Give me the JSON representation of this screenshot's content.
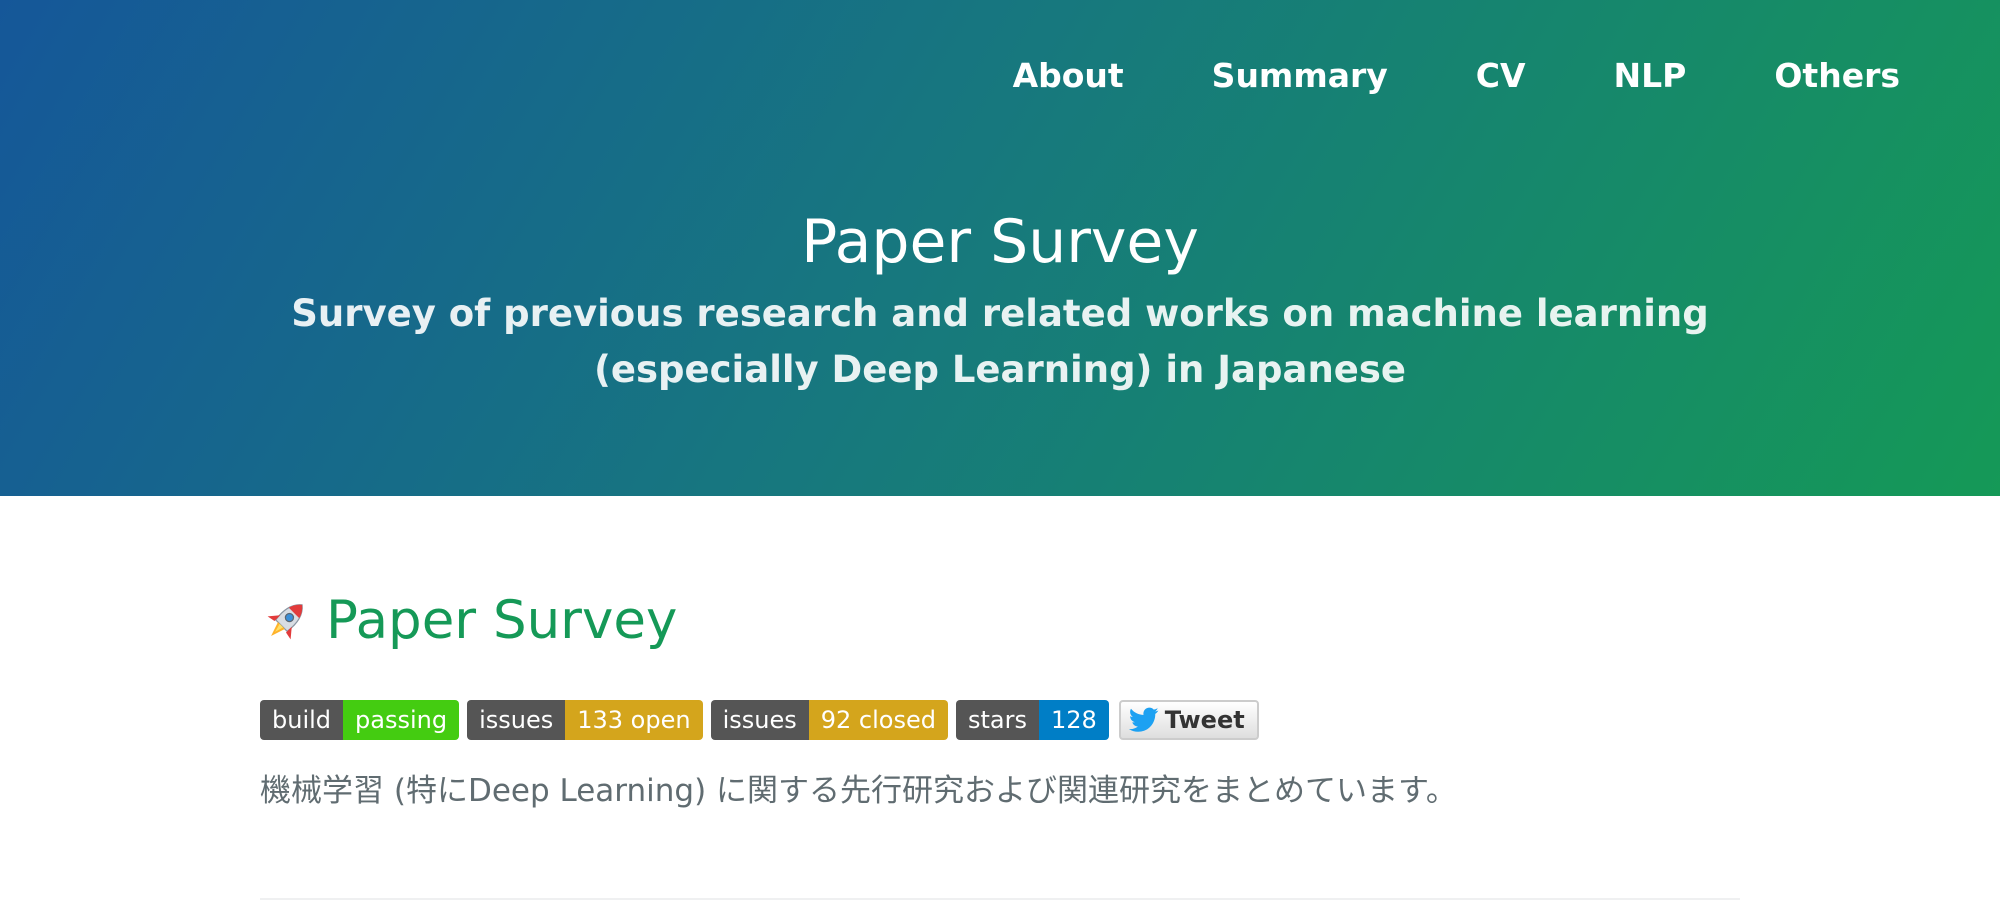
{
  "nav": {
    "items": [
      {
        "label": "About"
      },
      {
        "label": "Summary"
      },
      {
        "label": "CV"
      },
      {
        "label": "NLP"
      },
      {
        "label": "Others"
      }
    ]
  },
  "hero": {
    "title": "Paper Survey",
    "tagline": "Survey of previous research and related works on machine learning (especially Deep Learning) in Japanese"
  },
  "content": {
    "title": "Paper Survey",
    "title_icon": "rocket-icon",
    "badges": [
      {
        "label": "build",
        "value": "passing",
        "color": "#44cc11"
      },
      {
        "label": "issues",
        "value": "133 open",
        "color": "#d4a51c"
      },
      {
        "label": "issues",
        "value": "92 closed",
        "color": "#d4a51c"
      },
      {
        "label": "stars",
        "value": "128",
        "color": "#007ec6"
      }
    ],
    "tweet_label": "Tweet",
    "description": "機械学習 (特にDeep Learning) に関する先行研究および関連研究をまとめています。"
  },
  "colors": {
    "gradient_start": "#155799",
    "gradient_end": "#159957",
    "accent": "#159957",
    "body_text": "#606c71"
  }
}
